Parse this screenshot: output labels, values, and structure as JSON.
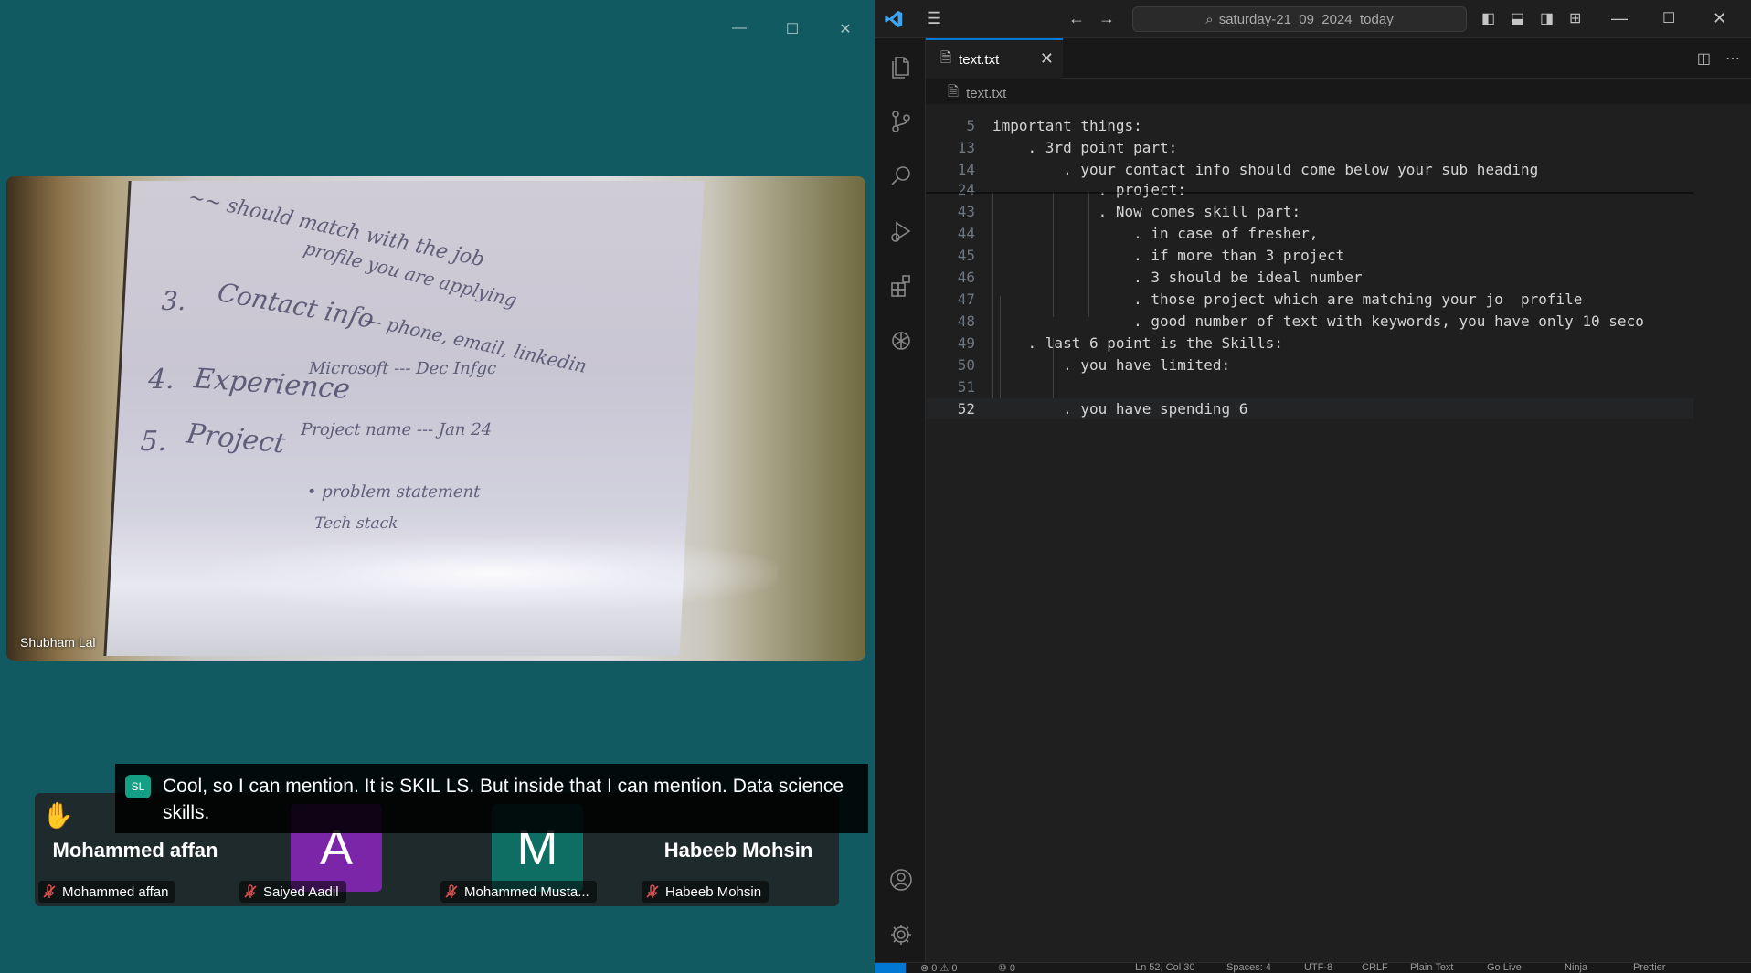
{
  "meeting": {
    "video": {
      "speaker_name": "Shubham Lal"
    },
    "caption": {
      "initials": "SL",
      "text": "Cool, so I can mention. It is SKIL LS. But inside that I can mention. Data science skills."
    },
    "participants": [
      {
        "display": "Mohammed affan",
        "label": "Mohammed affan",
        "hand_raised": true,
        "muted": true
      },
      {
        "display": "A",
        "label": "Saiyed Aadil",
        "avatar_color": "#7b26a8",
        "muted": true
      },
      {
        "display": "M",
        "label": "Mohammed Musta...",
        "avatar_color": "#0e6e63",
        "muted": true
      },
      {
        "display": "Habeeb Mohsin",
        "label": "Habeeb Mohsin",
        "muted": true
      }
    ]
  },
  "vscode": {
    "search_label": "saturday-21_09_2024_today",
    "tab": {
      "label": "text.txt"
    },
    "breadcrumb": "text.txt",
    "lines": [
      {
        "n": "5",
        "text": "important things:"
      },
      {
        "n": "13",
        "text": "    . 3rd point part:"
      },
      {
        "n": "14",
        "text": "        . your contact info should come below your sub heading"
      },
      {
        "n": "24",
        "text": "            . project:"
      },
      {
        "n": "43",
        "text": "            . Now comes skill part:"
      },
      {
        "n": "44",
        "text": "                . in case of fresher,"
      },
      {
        "n": "45",
        "text": "                . if more than 3 project"
      },
      {
        "n": "46",
        "text": "                . 3 should be ideal number"
      },
      {
        "n": "47",
        "text": "                . those project which are matching your jo  profile"
      },
      {
        "n": "48",
        "text": "                . good number of text with keywords, you have only 10 seco"
      },
      {
        "n": "49",
        "text": "    . last 6 point is the Skills:"
      },
      {
        "n": "50",
        "text": "        . you have limited:"
      },
      {
        "n": "51",
        "text": ""
      },
      {
        "n": "52",
        "text": "        . you have spending 6"
      }
    ],
    "status": {
      "problems": "⊗ 0 ⚠ 0",
      "ports": "⑩ 0",
      "position": "Ln 52, Col 30",
      "spaces": "Spaces: 4",
      "encoding": "UTF-8",
      "eol": "CRLF",
      "language": "Plain Text",
      "golive": "Go Live",
      "ninja": "Ninja",
      "prettier": "Prettier"
    },
    "colors": {
      "accent": "#0078d4",
      "editor_bg": "#1f1f1f"
    }
  },
  "whiteboard": {
    "items": [
      "3.",
      "Contact info",
      "4.",
      "Experience",
      "5.",
      "Project"
    ]
  }
}
